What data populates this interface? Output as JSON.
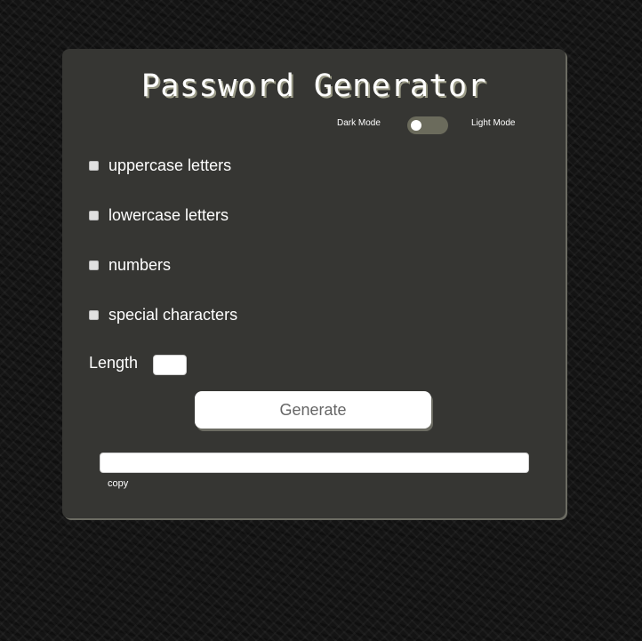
{
  "app": {
    "title": "Password Generator"
  },
  "theme_toggle": {
    "dark_label": "Dark Mode",
    "light_label": "Light Mode",
    "state": "dark"
  },
  "options": [
    {
      "label": "uppercase letters",
      "checked": false
    },
    {
      "label": "lowercase letters",
      "checked": false
    },
    {
      "label": "numbers",
      "checked": false
    },
    {
      "label": "special characters",
      "checked": false
    }
  ],
  "length": {
    "label": "Length",
    "value": ""
  },
  "generate": {
    "label": "Generate"
  },
  "output": {
    "value": "",
    "copy_label": "copy"
  },
  "colors": {
    "page_background": "#141414",
    "card_background": "#363633",
    "card_shadow": "#6b6b62",
    "toggle_track": "#6b6b5c",
    "text": "#ffffff",
    "button_text": "#666666"
  }
}
